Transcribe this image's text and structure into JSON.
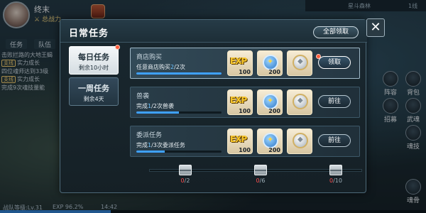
{
  "player": {
    "name": "终末",
    "power_label": "总战力"
  },
  "map": {
    "name": "星斗森林",
    "line": "1线"
  },
  "side_tabs": [
    "任务",
    "队伍"
  ],
  "quest_feed": [
    {
      "tag": "",
      "text": "击败拦路的大地王蝎"
    },
    {
      "tag": "支线",
      "text": "实力成长"
    },
    {
      "tag": "",
      "text": "四位魂师达到33级"
    },
    {
      "tag": "支线",
      "text": "实力成长"
    },
    {
      "tag": "",
      "text": "完成9次魂技量能"
    }
  ],
  "bottom_bar": {
    "team_level": "战队等级:Lv.31",
    "exp": "EXP 96.2%",
    "time": "14:42",
    "exp_fraction": 0.962
  },
  "right_menu": [
    "阵容",
    "背包",
    "招募",
    "武魂",
    "魂技",
    "魂骨"
  ],
  "popup": {
    "title": "日常任务",
    "claim_all": "全部领取",
    "close_icon": "close-icon",
    "tabs": [
      {
        "name": "每日任务",
        "sub": "剩余10小时",
        "active": true,
        "red_dot": true
      },
      {
        "name": "一周任务",
        "sub": "剩余4天",
        "active": false,
        "red_dot": false
      }
    ],
    "quests": [
      {
        "title": "商店购买",
        "desc_prefix": "任意商店购买",
        "current": "2",
        "desc_suffix": "/2次",
        "progress": 1.0,
        "rewards": [
          {
            "icon": "exp-icon",
            "label": "EXP",
            "qty": "100"
          },
          {
            "icon": "soul-coin-icon",
            "qty": "200"
          },
          {
            "icon": "medal-icon",
            "qty": ""
          }
        ],
        "action": "领取",
        "action_type": "claim",
        "highlight": true,
        "red_dot": true
      },
      {
        "title": "兽袭",
        "desc_prefix": "完成",
        "current": "1",
        "desc_suffix": "/2次兽袭",
        "progress": 0.5,
        "rewards": [
          {
            "icon": "exp-icon",
            "label": "EXP",
            "qty": "100"
          },
          {
            "icon": "soul-coin-icon",
            "qty": "200"
          },
          {
            "icon": "medal-icon",
            "qty": ""
          }
        ],
        "action": "前往",
        "action_type": "go",
        "highlight": false,
        "red_dot": false
      },
      {
        "title": "委派任务",
        "desc_prefix": "完成",
        "current": "1",
        "desc_suffix": "/3次委派任务",
        "progress": 0.33,
        "rewards": [
          {
            "icon": "exp-icon",
            "label": "EXP",
            "qty": "100"
          },
          {
            "icon": "soul-coin-icon",
            "qty": "200"
          },
          {
            "icon": "medal-icon",
            "qty": ""
          }
        ],
        "action": "前往",
        "action_type": "go",
        "highlight": false,
        "red_dot": false
      }
    ],
    "chests": [
      {
        "current": "0",
        "total": "/2"
      },
      {
        "current": "0",
        "total": "/6"
      },
      {
        "current": "0",
        "total": "/10"
      }
    ]
  },
  "colors": {
    "accent_blue": "#3fa1ff",
    "alert_red": "#ff5a3a",
    "count_red": "#ff5050"
  }
}
